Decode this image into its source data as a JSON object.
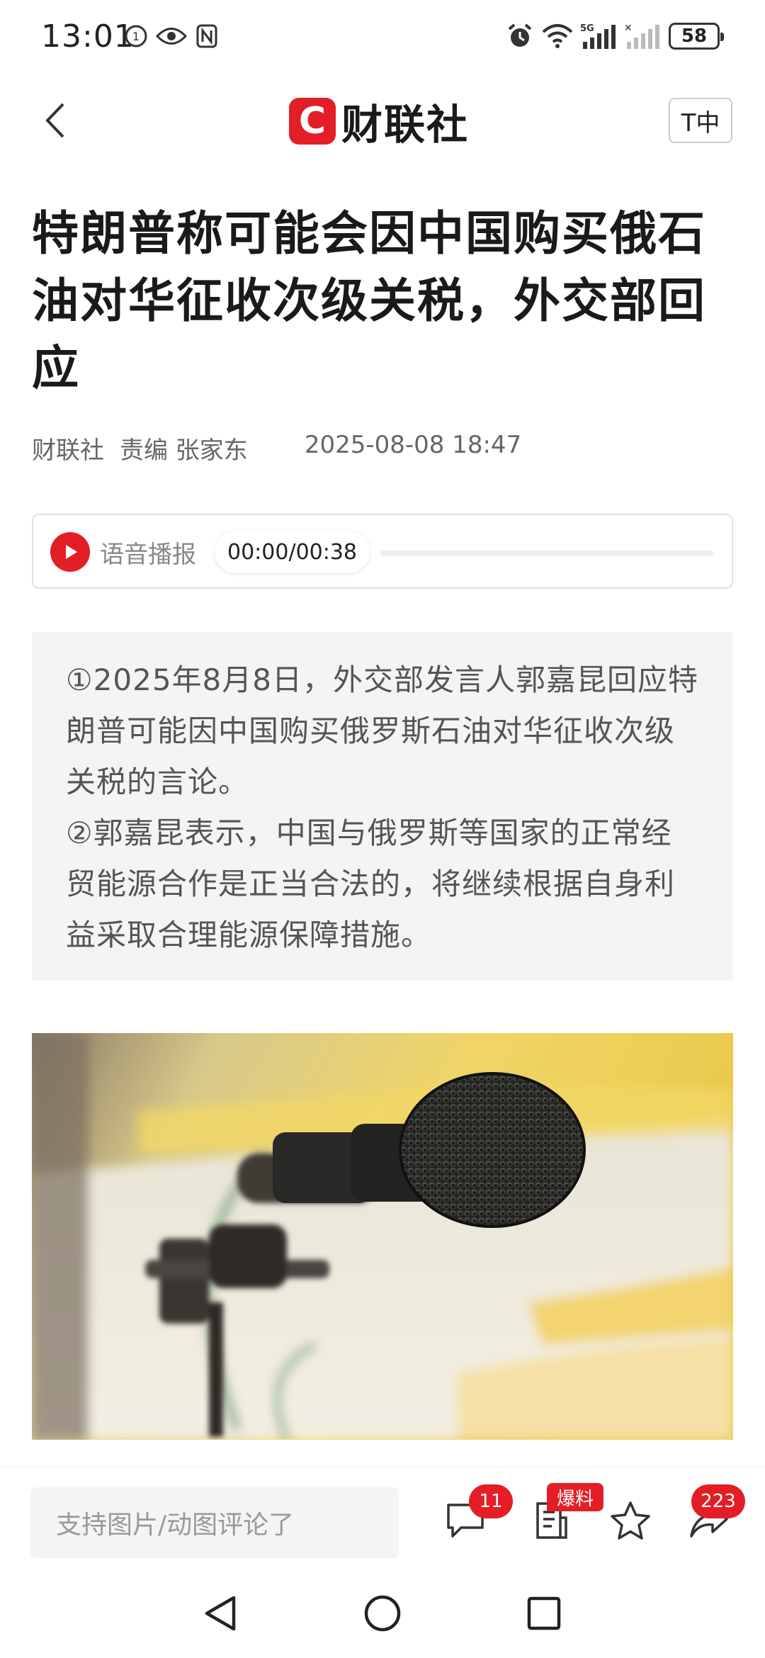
{
  "status_bar": {
    "time": "13:01",
    "battery": "58",
    "network": "5G"
  },
  "header": {
    "logo_mark": "C",
    "logo_text": "财联社",
    "font_size_button": "T中"
  },
  "article": {
    "title": "特朗普称可能会因中国购买俄石油对华征收次级关税，外交部回应",
    "source": "财联社",
    "editor": "责编 张家东",
    "datetime": "2025-08-08 18:47"
  },
  "audio": {
    "label": "语音播报",
    "time": "00:00/00:38",
    "progress": 0
  },
  "summary": {
    "points": [
      "①2025年8月8日，外交部发言人郭嘉昆回应特朗普可能因中国购买俄罗斯石油对华征收次级关税的言论。",
      "②郭嘉昆表示，中国与俄罗斯等国家的正常经贸能源合作是正当合法的，将继续根据自身利益采取合理能源保障措施。"
    ]
  },
  "bottom_bar": {
    "comment_placeholder": "支持图片/动图评论了",
    "comment_count": "11",
    "baoliao_label": "爆料",
    "share_count": "223"
  },
  "colors": {
    "brand_red": "#e41e26",
    "summary_bg": "#f4f4f4",
    "meta_gray": "#666666"
  },
  "icons": [
    "back-arrow-icon",
    "play-icon",
    "comment-icon",
    "news-icon",
    "star-icon",
    "share-icon",
    "alarm-icon",
    "wifi-icon",
    "signal-icon",
    "nav-back-icon",
    "nav-home-icon",
    "nav-recent-icon"
  ]
}
